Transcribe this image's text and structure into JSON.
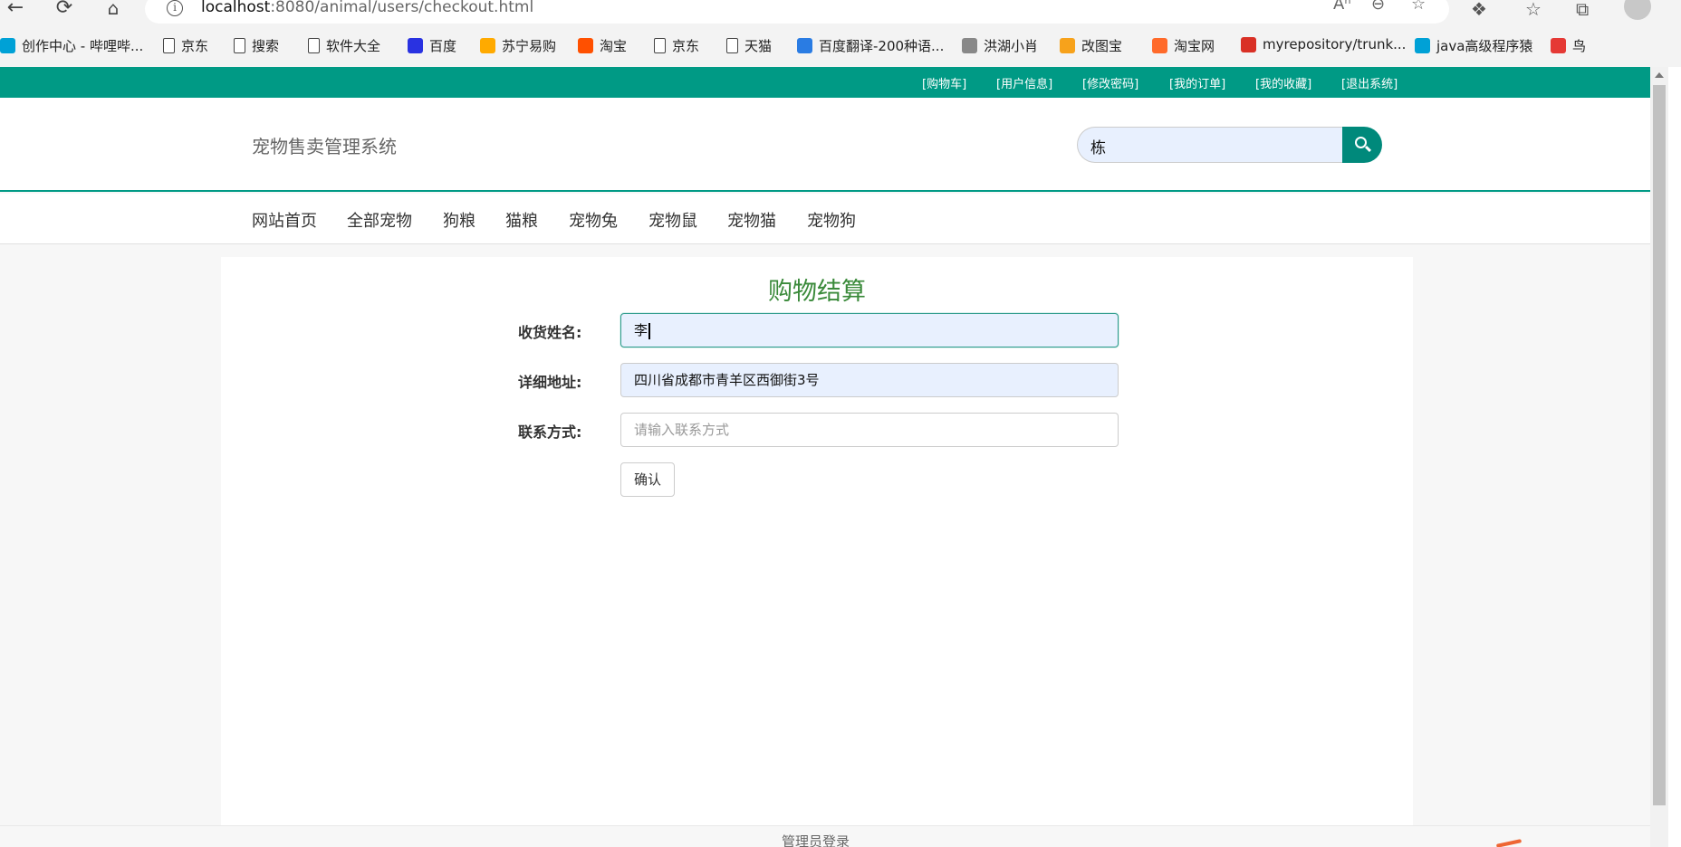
{
  "browser": {
    "url_host": "localhost",
    "url_path": ":8080/animal/users/checkout.html",
    "bookmarks": [
      {
        "label": "创作中心 - 哔哩哔...",
        "icon": "bilibili-icon",
        "color": "#00a1d6"
      },
      {
        "label": "京东",
        "icon": "page-icon"
      },
      {
        "label": "搜索",
        "icon": "page-icon"
      },
      {
        "label": "软件大全",
        "icon": "page-icon"
      },
      {
        "label": "百度",
        "icon": "baidu-icon",
        "color": "#2932e1"
      },
      {
        "label": "苏宁易购",
        "icon": "suning-icon",
        "color": "#ffaa00"
      },
      {
        "label": "淘宝",
        "icon": "taobao-icon",
        "color": "#ff5000"
      },
      {
        "label": "京东",
        "icon": "page-icon"
      },
      {
        "label": "天猫",
        "icon": "page-icon"
      },
      {
        "label": "百度翻译-200种语...",
        "icon": "translate-icon",
        "color": "#2a7ce3"
      },
      {
        "label": "洪湖小肖",
        "icon": "bird-icon",
        "color": "#888888"
      },
      {
        "label": "改图宝",
        "icon": "gaitubao-icon",
        "color": "#f7a21b"
      },
      {
        "label": "淘宝网",
        "icon": "taobao-icon",
        "color": "#ff6a2a"
      },
      {
        "label": "myrepository/trunk...",
        "icon": "chrome-icon",
        "color": "#d93025"
      },
      {
        "label": "java高级程序猿",
        "icon": "bilibili-icon",
        "color": "#00a1d6"
      },
      {
        "label": "鸟",
        "icon": "bird-icon",
        "color": "#e53935"
      }
    ]
  },
  "topbar": {
    "links": [
      "[购物车]",
      "[用户信息]",
      "[修改密码]",
      "[我的订单]",
      "[我的收藏]",
      "[退出系统]"
    ]
  },
  "header": {
    "site_title": "宠物售卖管理系统",
    "search_value": "栋"
  },
  "menu": {
    "items": [
      "网站首页",
      "全部宠物",
      "狗粮",
      "猫粮",
      "宠物兔",
      "宠物鼠",
      "宠物猫",
      "宠物狗"
    ]
  },
  "checkout": {
    "heading": "购物结算",
    "name_label": "收货姓名:",
    "name_value": "李",
    "address_label": "详细地址:",
    "address_value": "四川省成都市青羊区西御街3号",
    "contact_label": "联系方式:",
    "contact_placeholder": "请输入联系方式",
    "confirm_label": "确认"
  },
  "footer": {
    "admin_login": "管理员登录"
  },
  "colors": {
    "brand": "#009a85",
    "heading_green": "#3a8a3a",
    "autofill_blue": "#e8f0fe"
  }
}
